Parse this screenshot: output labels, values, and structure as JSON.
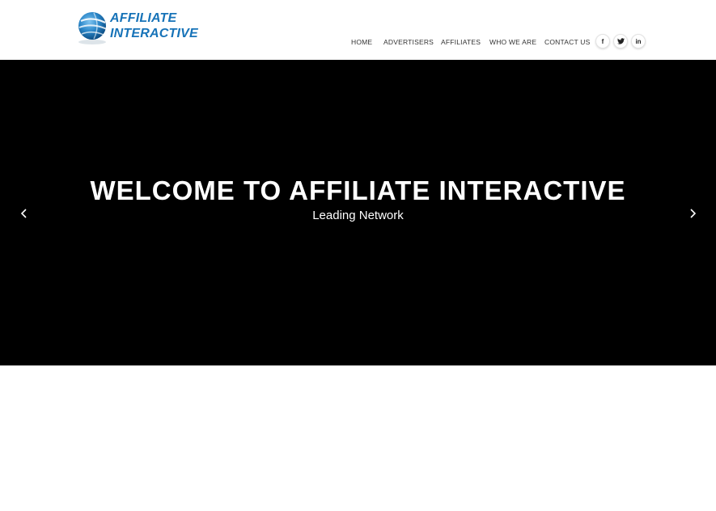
{
  "brand": {
    "line1": "AFFILIATE",
    "line2": "INTERACTIVE",
    "color": "#1773b8",
    "icon": "globe-icon"
  },
  "nav": {
    "items": [
      {
        "label": "HOME"
      },
      {
        "label": "ADVERTISERS"
      },
      {
        "label": "AFFILIATES"
      },
      {
        "label": "WHO WE ARE"
      },
      {
        "label": "CONTACT US"
      }
    ]
  },
  "social": [
    {
      "glyph": "f",
      "icon": "facebook-icon"
    },
    {
      "glyph": "t",
      "icon": "twitter-icon"
    },
    {
      "glyph": "in",
      "icon": "linkedin-icon"
    }
  ],
  "hero": {
    "title": "WELCOME TO AFFILIATE INTERACTIVE",
    "subtitle": "Leading Network",
    "background": "#000000",
    "prev_icon": "chevron-left-icon",
    "next_icon": "chevron-right-icon"
  }
}
